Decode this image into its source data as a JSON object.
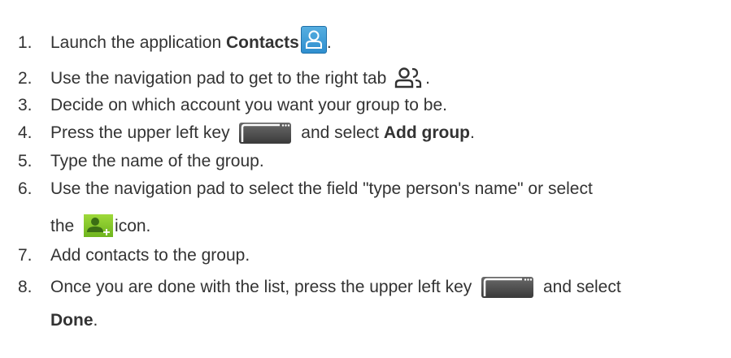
{
  "steps": [
    {
      "number": "1.",
      "text_before": "Launch the application ",
      "bold": "Contacts",
      "text_after": ".",
      "icon": "contacts-app-icon"
    },
    {
      "number": "2.",
      "text_before": "Use the navigation pad to get to the right tab ",
      "text_after": ".",
      "icon": "groups-tab-icon"
    },
    {
      "number": "3.",
      "text_before": "Decide on which account you want your group to be."
    },
    {
      "number": "4.",
      "text_before": "Press the upper left key ",
      "text_middle": " and select ",
      "bold": "Add group",
      "text_after": ".",
      "icon": "menu-key-icon"
    },
    {
      "number": "5.",
      "text_before": "Type the name of the group."
    },
    {
      "number": "6.",
      "text_before": "Use the navigation pad to select the field \"type person's name\" or select",
      "line2_before": "the ",
      "line2_after": "icon.",
      "icon": "add-person-icon"
    },
    {
      "number": "7.",
      "text_before": "Add contacts to the group."
    },
    {
      "number": "8.",
      "text_before": "Once you are done with the list, press the upper left key ",
      "text_middle": " and select",
      "line2_bold": "Done",
      "line2_after": ".",
      "icon": "menu-key-icon"
    }
  ],
  "colors": {
    "text": "#333333",
    "contacts_icon": "#3d9ad8",
    "menu_key": "#4a4a4a",
    "add_person_icon": "#8cc63f"
  }
}
